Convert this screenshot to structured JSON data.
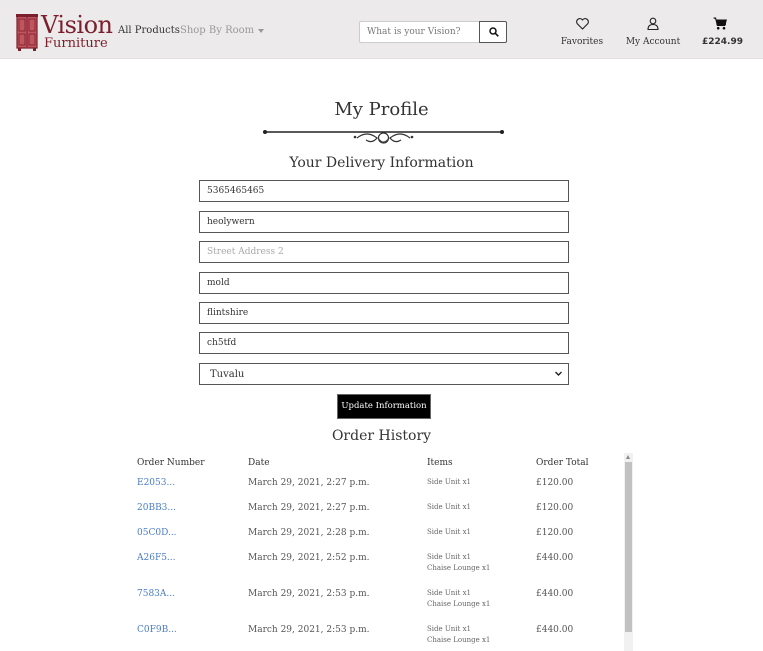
{
  "header": {
    "brand_title": "Vision",
    "brand_subtitle": "Furniture",
    "nav_all": "All Products",
    "nav_shop": "Shop By Room",
    "search_placeholder": "What is your Vision?",
    "favorites": "Favorites",
    "account": "My Account",
    "cart_total": "£224.99"
  },
  "profile": {
    "title": "My Profile",
    "delivery_title": "Your Delivery Information",
    "fields": {
      "phone": "5365465465",
      "street1": "heolywern",
      "street2_placeholder": "Street Address 2",
      "town": "mold",
      "county": "flintshire",
      "postcode": "ch5tfd",
      "country": "Tuvalu"
    },
    "update_label": "Update Information"
  },
  "orders": {
    "title": "Order History",
    "headers": [
      "Order Number",
      "Date",
      "Items",
      "Order Total"
    ],
    "rows": [
      {
        "number": "E2053...",
        "date": "March 29, 2021, 2:27 p.m.",
        "items": [
          "Side Unit x1"
        ],
        "total": "£120.00"
      },
      {
        "number": "20BB3...",
        "date": "March 29, 2021, 2:27 p.m.",
        "items": [
          "Side Unit x1"
        ],
        "total": "£120.00"
      },
      {
        "number": "05C0D...",
        "date": "March 29, 2021, 2:28 p.m.",
        "items": [
          "Side Unit x1"
        ],
        "total": "£120.00"
      },
      {
        "number": "A26F5...",
        "date": "March 29, 2021, 2:52 p.m.",
        "items": [
          "Side Unit x1",
          "Chaise Lounge x1"
        ],
        "total": "£440.00"
      },
      {
        "number": "7583A...",
        "date": "March 29, 2021, 2:53 p.m.",
        "items": [
          "Side Unit x1",
          "Chaise Lounge x1"
        ],
        "total": "£440.00"
      },
      {
        "number": "C0F9B...",
        "date": "March 29, 2021, 2:53 p.m.",
        "items": [
          "Side Unit x1",
          "Chaise Lounge x1"
        ],
        "total": "£440.00"
      }
    ]
  },
  "colors": {
    "brand": "#7a1f2b",
    "link": "#4a7cc7",
    "header_bg": "#eceaea"
  },
  "icons": {
    "logo": "wardrobe-icon",
    "search": "search-icon",
    "favorites": "heart-icon",
    "account": "user-icon",
    "cart": "cart-icon",
    "select": "chevron-down-icon"
  }
}
